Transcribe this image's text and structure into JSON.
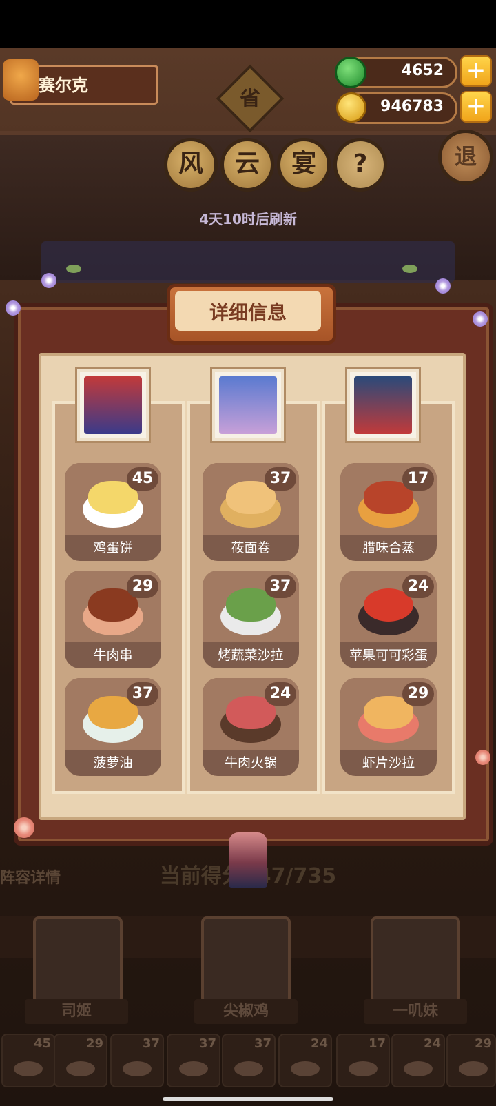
{
  "player": {
    "name": "赛尔克"
  },
  "currency": {
    "jade": "4652",
    "gold": "946783",
    "plus": "+"
  },
  "title": {
    "province": "省",
    "chars": [
      "风",
      "云",
      "宴"
    ],
    "help": "?",
    "exit": "退",
    "refresh": "4天10时后刷新"
  },
  "panel": {
    "title": "详细信息",
    "columns": [
      {
        "dishes": [
          {
            "name": "鸡蛋饼",
            "count": "45",
            "color": "#f4d76a"
          },
          {
            "name": "牛肉串",
            "count": "29",
            "color": "#8a3a20"
          },
          {
            "name": "菠萝油",
            "count": "37",
            "color": "#e8a842"
          }
        ]
      },
      {
        "dishes": [
          {
            "name": "莜面卷",
            "count": "37",
            "color": "#f0c27a"
          },
          {
            "name": "烤蔬菜沙拉",
            "count": "37",
            "color": "#6aa04a"
          },
          {
            "name": "牛肉火锅",
            "count": "24",
            "color": "#d25a5a"
          }
        ]
      },
      {
        "dishes": [
          {
            "name": "腊味合蒸",
            "count": "17",
            "color": "#b8442a"
          },
          {
            "name": "苹果可可彩蛋",
            "count": "24",
            "color": "#d83a2a"
          },
          {
            "name": "虾片沙拉",
            "count": "29",
            "color": "#f0b560"
          }
        ]
      }
    ]
  },
  "bottom": {
    "lineup_label": "阵容详情",
    "score": "当前得分147/735",
    "heroes": [
      "司姬",
      "尖椒鸡",
      "一叽妹"
    ],
    "mini_counts": [
      "45",
      "29",
      "37",
      "37",
      "37",
      "24",
      "17",
      "24",
      "29"
    ]
  }
}
